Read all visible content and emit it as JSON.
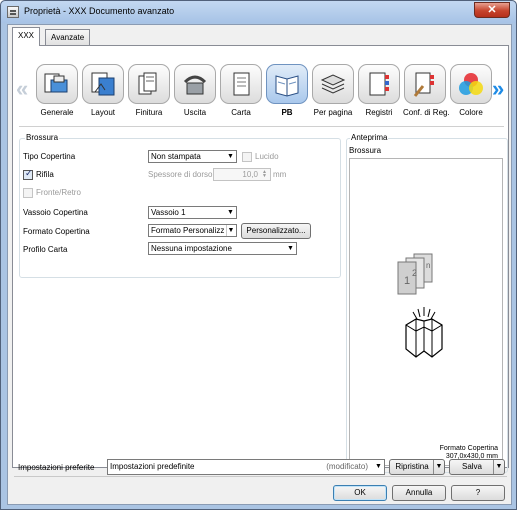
{
  "window": {
    "title": "Proprietà - XXX Documento avanzato",
    "close_label": "✕"
  },
  "tabs": [
    {
      "label": "XXX",
      "active": true
    },
    {
      "label": "Avanzate",
      "active": false
    }
  ],
  "toolbar": {
    "items": [
      {
        "label": "Generale",
        "icon": "general-icon",
        "selected": false
      },
      {
        "label": "Layout",
        "icon": "layout-icon",
        "selected": false
      },
      {
        "label": "Finitura",
        "icon": "finishing-icon",
        "selected": false
      },
      {
        "label": "Uscita",
        "icon": "output-icon",
        "selected": false
      },
      {
        "label": "Carta",
        "icon": "paper-icon",
        "selected": false
      },
      {
        "label": "PB",
        "icon": "booklet-icon",
        "selected": true
      },
      {
        "label": "Per pagina",
        "icon": "per-page-icon",
        "selected": false
      },
      {
        "label": "Registri",
        "icon": "tabs-icon",
        "selected": false
      },
      {
        "label": "Conf. di Reg.",
        "icon": "tab-settings-icon",
        "selected": false
      },
      {
        "label": "Colore",
        "icon": "color-icon",
        "selected": false
      }
    ]
  },
  "brossura": {
    "group_title": "Brossura",
    "tipo_copertina_label": "Tipo Copertina",
    "tipo_copertina_value": "Non stampata",
    "lucido_label": "Lucido",
    "lucido_checked": false,
    "rifila_label": "Rifila",
    "rifila_checked": true,
    "spessore_label": "Spessore di dorso",
    "spessore_value": "10,0",
    "spessore_unit": "mm",
    "fronte_retro_label": "Fronte/Retro",
    "fronte_retro_checked": false,
    "vassoio_label": "Vassoio Copertina",
    "vassoio_value": "Vassoio 1",
    "formato_label": "Formato Copertina",
    "formato_value": "Formato Personalizza",
    "personalizzato_button": "Personalizzato...",
    "profilo_label": "Profilo Carta",
    "profilo_value": "Nessuna impostazione"
  },
  "anteprima": {
    "group_title": "Anteprima",
    "subtitle": "Brossura",
    "caption_line1": "Formato Copertina",
    "caption_line2": "307,0x430,0 mm",
    "page_numbers": [
      "1",
      "2",
      "n"
    ]
  },
  "favorites": {
    "label": "Impostazioni preferite",
    "value": "Impostazioni predefinite",
    "status": "(modificato)",
    "restore_button": "Ripristina",
    "save_button": "Salva"
  },
  "dialog_buttons": {
    "ok": "OK",
    "cancel": "Annulla",
    "help": "?"
  },
  "colors": {
    "title_bar": "#aac4e3",
    "accent": "#1e8be6",
    "close_button": "#c6442d"
  }
}
